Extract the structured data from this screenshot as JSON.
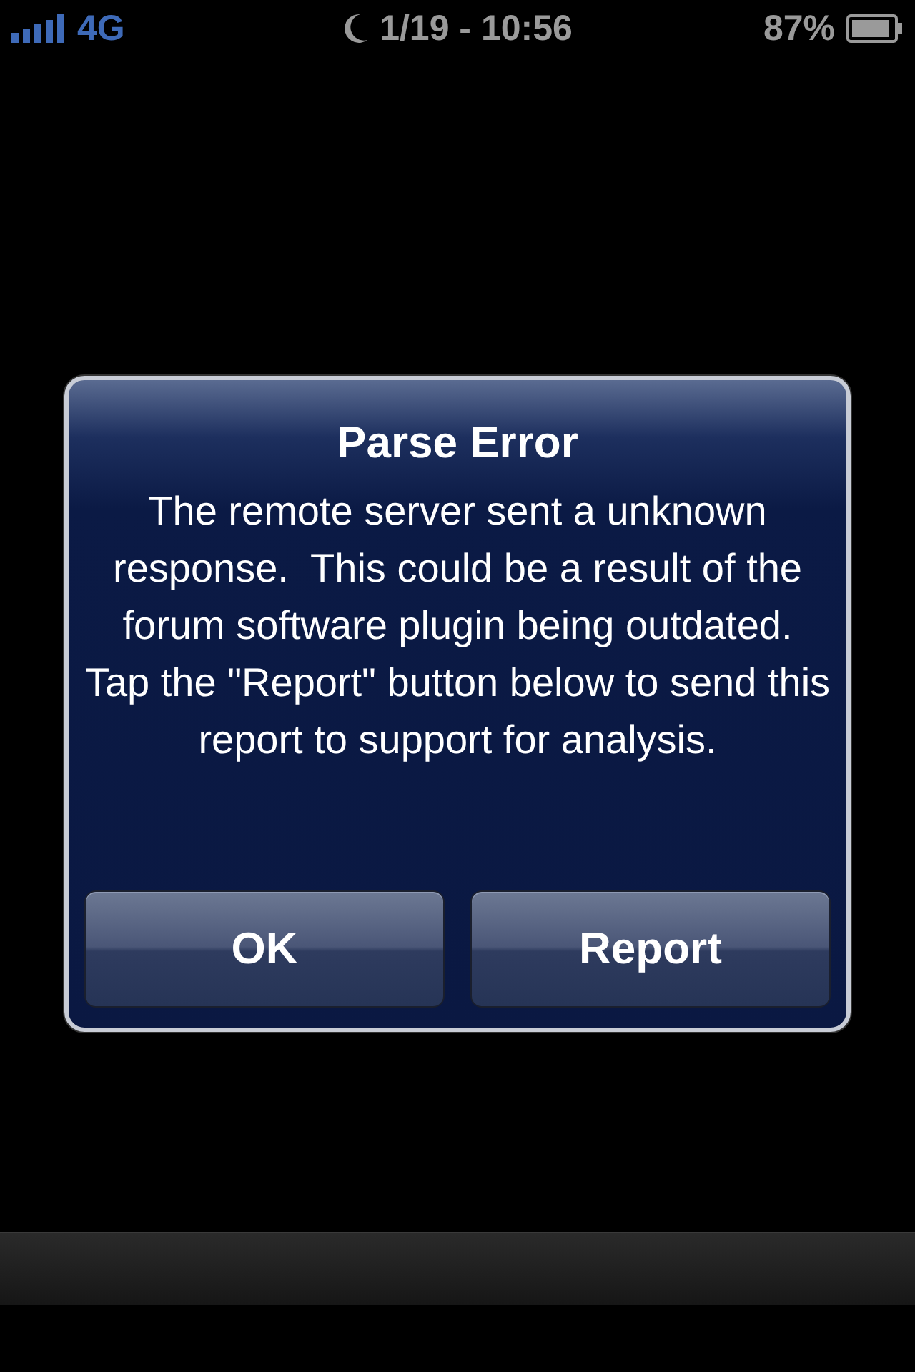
{
  "status_bar": {
    "network": "4G",
    "time": "1/19 - 10:56",
    "battery": "87%"
  },
  "alert": {
    "title": "Parse Error",
    "message": "The remote server sent a unknown response.  This could be a result of the forum software plugin being outdated.  Tap the \"Report\" button below to send this report to support for analysis.",
    "buttons": [
      {
        "label": "OK"
      },
      {
        "label": "Report"
      }
    ]
  }
}
